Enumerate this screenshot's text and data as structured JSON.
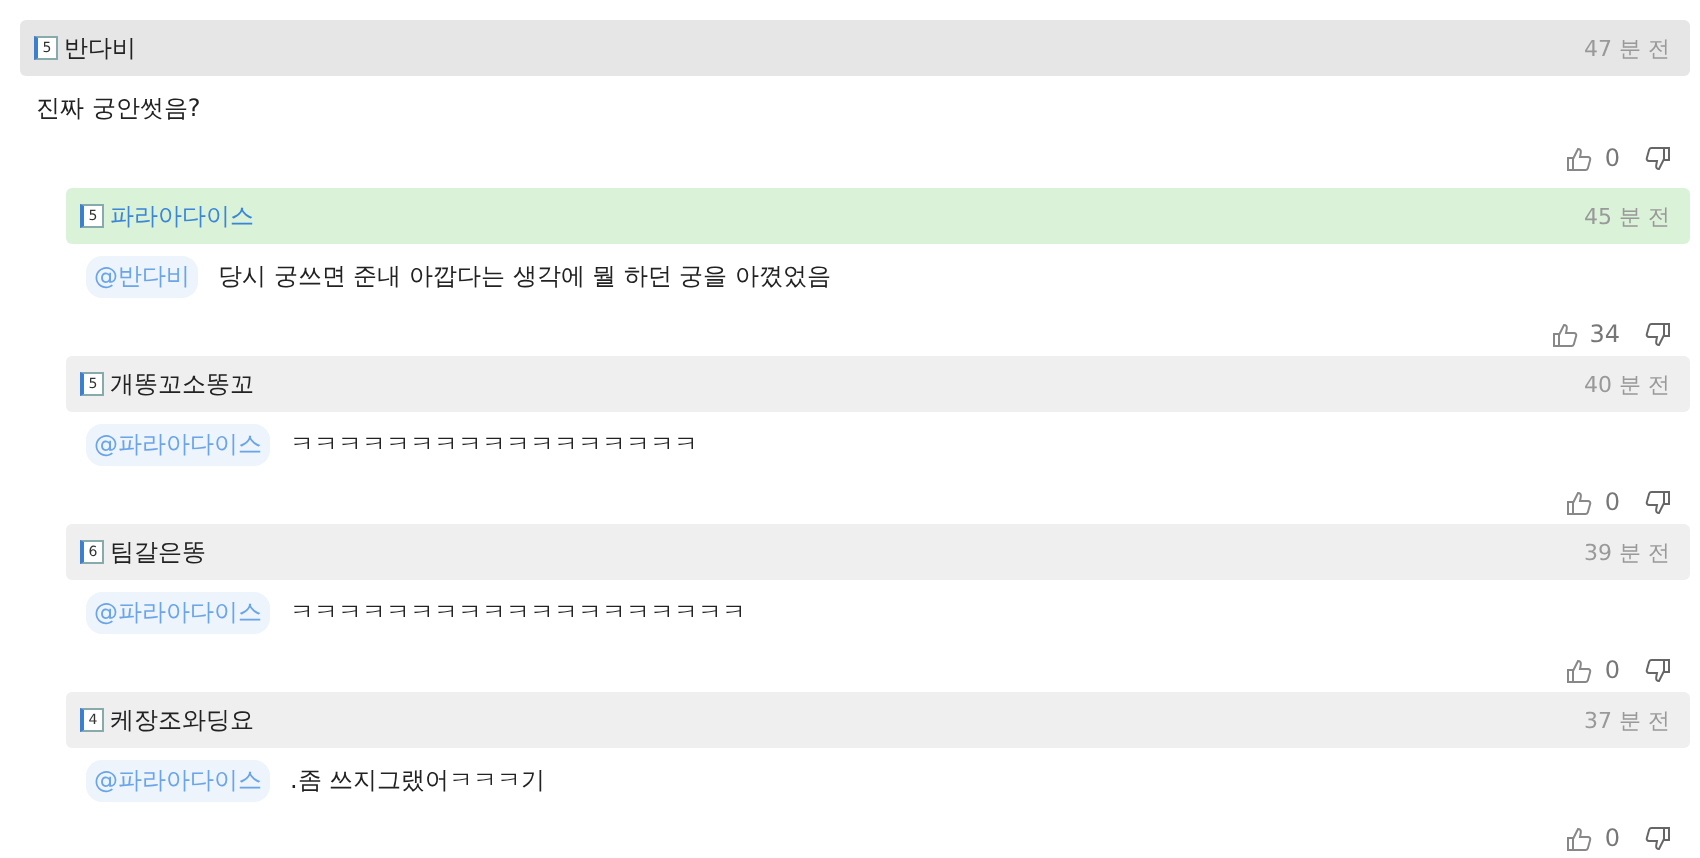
{
  "comment": {
    "author": "반다비",
    "level_badge": "5",
    "time": "47 분 전",
    "text": "진짜 궁안썻음?",
    "likes": "0"
  },
  "replies": [
    {
      "author": "파라아다이스",
      "level_badge": "5",
      "time": "45 분 전",
      "highlighted": true,
      "mention": "@반다비",
      "text": "당시 궁쓰면 준내 아깝다는 생각에 뭘 하던 궁을 아꼈었음",
      "likes": "34"
    },
    {
      "author": "개똥꼬소똥꼬",
      "level_badge": "5",
      "time": "40 분 전",
      "highlighted": false,
      "mention": "@파라아다이스",
      "text": "ㅋㅋㅋㅋㅋㅋㅋㅋㅋㅋㅋㅋㅋㅋㅋㅋㅋ",
      "likes": "0"
    },
    {
      "author": "팀갈은똥",
      "level_badge": "6",
      "time": "39 분 전",
      "highlighted": false,
      "mention": "@파라아다이스",
      "text": "ㅋㅋㅋㅋㅋㅋㅋㅋㅋㅋㅋㅋㅋㅋㅋㅋㅋㅋㅋ",
      "likes": "0"
    },
    {
      "author": "케장조와딩요",
      "level_badge": "4",
      "time": "37 분 전",
      "highlighted": false,
      "mention": "@파라아다이스",
      "text": ".좀 쓰지그랬어ㅋㅋㅋ기",
      "likes": "0"
    }
  ]
}
